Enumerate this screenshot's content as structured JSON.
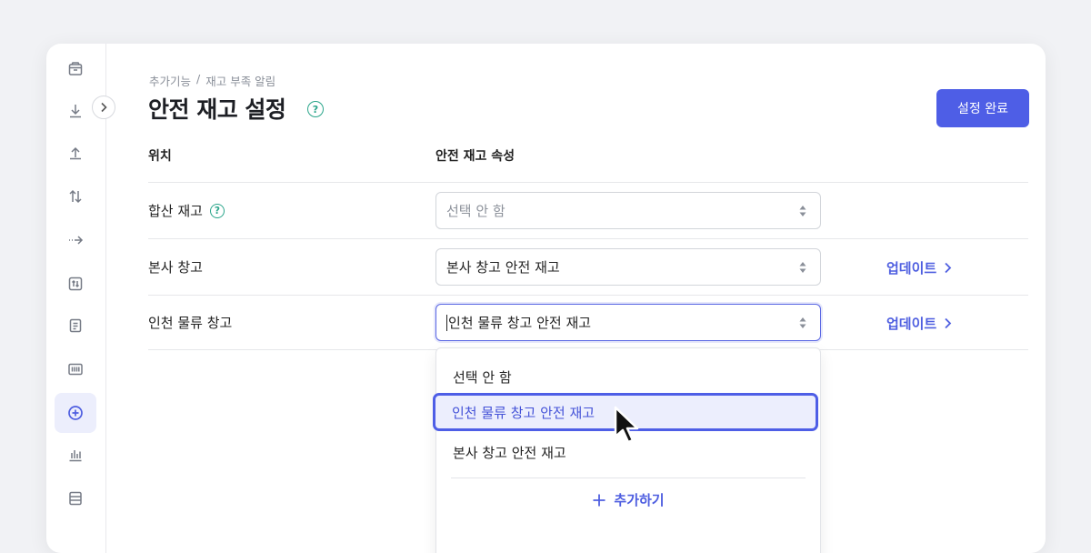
{
  "sidebar": {
    "items": [
      {
        "icon": "box-icon"
      },
      {
        "icon": "download-icon"
      },
      {
        "icon": "upload-icon"
      },
      {
        "icon": "transfer-icon"
      },
      {
        "icon": "move-arrow-icon"
      },
      {
        "icon": "adjust-icon"
      },
      {
        "icon": "document-icon"
      },
      {
        "icon": "barcode-icon"
      },
      {
        "icon": "plus-circle-icon",
        "active": true
      },
      {
        "icon": "bar-chart-icon"
      },
      {
        "icon": "list-icon"
      }
    ]
  },
  "header": {
    "breadcrumb": [
      "추가기능",
      "/",
      "재고 부족 알림"
    ],
    "title": "안전 재고 설정",
    "help_mark": "?",
    "confirm_label": "설정 완료"
  },
  "table": {
    "col_location": "위치",
    "col_attribute": "안전 재고 속성",
    "rows": [
      {
        "location": "합산 재고",
        "has_help": true,
        "value": "선택 안 함",
        "placeholder": true,
        "update": ""
      },
      {
        "location": "본사 창고",
        "has_help": false,
        "value": "본사 창고 안전 재고",
        "placeholder": false,
        "update": "업데이트"
      },
      {
        "location": "인천 물류 창고",
        "has_help": false,
        "value": "인천 물류 창고 안전 재고",
        "placeholder": false,
        "update": "업데이트"
      }
    ]
  },
  "dropdown": {
    "options": [
      "선택 안 함",
      "인천 물류 창고 안전 재고",
      "본사 창고 안전 재고"
    ],
    "highlighted_index": 1,
    "add_label": "추가하기"
  },
  "colors": {
    "accent": "#4e5ee6",
    "help": "#2aa58a",
    "background": "#f1f2f5"
  }
}
